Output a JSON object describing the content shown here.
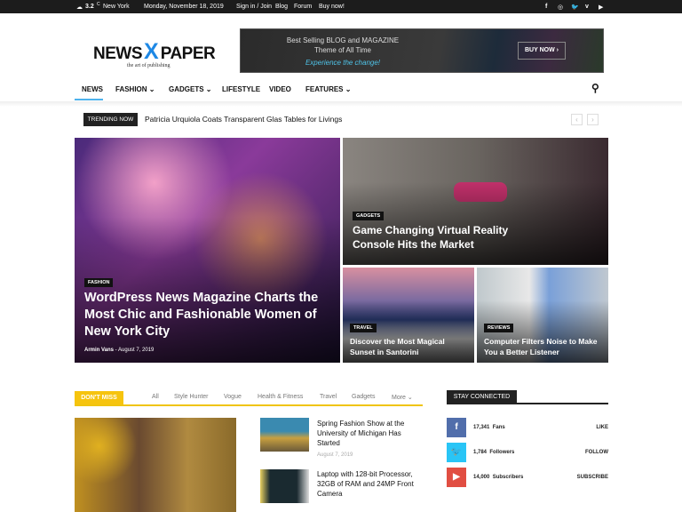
{
  "topbar": {
    "temp": "3.2",
    "unit": "C",
    "city": "New York",
    "date": "Monday, November 18, 2019",
    "links": [
      "Sign in / Join",
      "Blog",
      "Forum",
      "Buy now!"
    ],
    "social": [
      "facebook-icon",
      "instagram-icon",
      "twitter-icon",
      "vimeo-icon",
      "youtube-icon"
    ]
  },
  "logo": {
    "left": "NEWS",
    "x": "X",
    "right": "PAPER",
    "tagline": "the art of publishing"
  },
  "banner": {
    "line1": "Best Selling BLOG and MAGAZINE",
    "line2": "Theme of All Time",
    "line3": "Experience the change!",
    "button": "BUY NOW ›"
  },
  "nav": {
    "items": [
      "NEWS",
      "FASHION ⌄",
      "GADGETS ⌄",
      "LIFESTYLE",
      "VIDEO",
      "FEATURES ⌄"
    ]
  },
  "trending": {
    "label": "TRENDING NOW",
    "text": "Patricia Urquiola Coats Transparent Glas Tables for Livings",
    "prev": "‹",
    "next": "›"
  },
  "hero": [
    {
      "category": "FASHION",
      "title": "WordPress News Magazine Charts the Most Chic and Fashionable Women of New York City",
      "author": "Armin Vans",
      "date": "August 7, 2019"
    },
    {
      "category": "GADGETS",
      "title": "Game Changing Virtual Reality Console Hits the Market"
    },
    {
      "category": "TRAVEL",
      "title": "Discover the Most Magical Sunset in Santorini"
    },
    {
      "category": "REVIEWS",
      "title": "Computer Filters Noise to Make You a Better Listener"
    }
  ],
  "dontmiss": {
    "label": "DON'T MISS",
    "tabs": [
      "All",
      "Style Hunter",
      "Vogue",
      "Health & Fitness",
      "Travel",
      "Gadgets",
      "More ⌄"
    ],
    "articles": [
      {
        "title": "Spring Fashion Show at the University of Michigan Has Started",
        "date": "August 7, 2019"
      },
      {
        "title": "Laptop with 128-bit Processor, 32GB of RAM and 24MP Front Camera"
      }
    ]
  },
  "stay": {
    "label": "STAY CONNECTED",
    "items": [
      {
        "icon": "f",
        "count": "17,341",
        "unit": "Fans",
        "action": "LIKE",
        "color": "#516eab"
      },
      {
        "icon": "🐦",
        "count": "1,784",
        "unit": "Followers",
        "action": "FOLLOW",
        "color": "#29c5f6"
      },
      {
        "icon": "▶",
        "count": "14,000",
        "unit": "Subscribers",
        "action": "SUBSCRIBE",
        "color": "#e14e42"
      }
    ]
  }
}
